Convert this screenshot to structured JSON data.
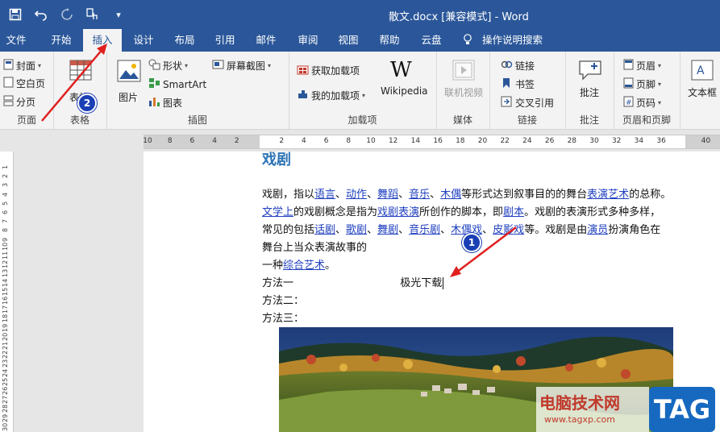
{
  "titlebar": {
    "doc_title": "散文.docx [兼容模式] - Word"
  },
  "tabs": [
    "文件",
    "开始",
    "插入",
    "设计",
    "布局",
    "引用",
    "邮件",
    "审阅",
    "视图",
    "帮助",
    "云盘"
  ],
  "active_tab": "插入",
  "tell_me": "操作说明搜索",
  "ribbon": {
    "pages": {
      "cover": "封面",
      "blank": "空白页",
      "break": "分页",
      "label": "页面"
    },
    "tables": {
      "table": "表格",
      "label": "表格"
    },
    "illustrations": {
      "picture": "图片",
      "shapes": "形状",
      "smartart": "SmartArt",
      "chart": "图表",
      "screenshot": "屏幕截图",
      "label": "插图"
    },
    "addins": {
      "get": "获取加载项",
      "my": "我的加载项",
      "wiki": "Wikipedia",
      "label": "加载项"
    },
    "media": {
      "video": "联机视频",
      "label": "媒体"
    },
    "links": {
      "link": "链接",
      "bookmark": "书签",
      "xref": "交叉引用",
      "label": "链接"
    },
    "comments": {
      "comment": "批注",
      "label": "批注"
    },
    "header_footer": {
      "header": "页眉",
      "footer": "页脚",
      "pagenum": "页码",
      "label": "页眉和页脚"
    },
    "text": {
      "textbox": "文本框"
    }
  },
  "ruler": {
    "top": [
      "10",
      "8",
      "6",
      "4",
      "2",
      "",
      "2",
      "4",
      "6",
      "8",
      "10",
      "12",
      "14",
      "16",
      "18",
      "20",
      "22",
      "24",
      "26",
      "28",
      "30",
      "32",
      "34",
      "36",
      "",
      "40"
    ],
    "left": [
      "1",
      "2",
      "3",
      "4",
      "5",
      "6",
      "7",
      "8",
      "9",
      "10",
      "11",
      "12",
      "13",
      "14",
      "15",
      "16",
      "17",
      "18",
      "19",
      "20",
      "21",
      "22",
      "23",
      "24",
      "25",
      "26",
      "27",
      "28",
      "29",
      "30"
    ]
  },
  "document": {
    "heading": "戏剧",
    "l1": [
      "戏剧，指以",
      "语言",
      "、",
      "动作",
      "、",
      "舞蹈",
      "、",
      "音乐",
      "、",
      "木偶",
      "等形式达到叙事目的的舞台",
      "表演艺术",
      "的总称。"
    ],
    "l2": [
      "文学上",
      "的戏剧概念是指为",
      "戏剧表演",
      "所创作的脚本，即",
      "剧本",
      "。戏剧的表演形式多种多样，"
    ],
    "l3": [
      "常见的包括",
      "话剧",
      "、",
      "歌剧",
      "、",
      "舞剧",
      "、",
      "音乐剧",
      "、",
      "木偶戏",
      "、",
      "皮影戏",
      "等。戏剧是由",
      "演员",
      "扮演角色在"
    ],
    "l4": "舞台上当众表演故事的",
    "l5": [
      "一种",
      "综合艺术",
      "。"
    ],
    "method1": "方法一",
    "method1_extra": "极光下载",
    "method2": "方法二：",
    "method3": "方法三："
  },
  "annotations": {
    "badge1": "1",
    "badge2": "2"
  },
  "watermark": {
    "cn": "电脑技术网",
    "url": "www.tagxp.com",
    "tag": "TAG"
  },
  "colors": {
    "brand": "#2b579a",
    "link": "#1f3fbf",
    "heading": "#2e74b5",
    "arrow": "#e02020"
  }
}
